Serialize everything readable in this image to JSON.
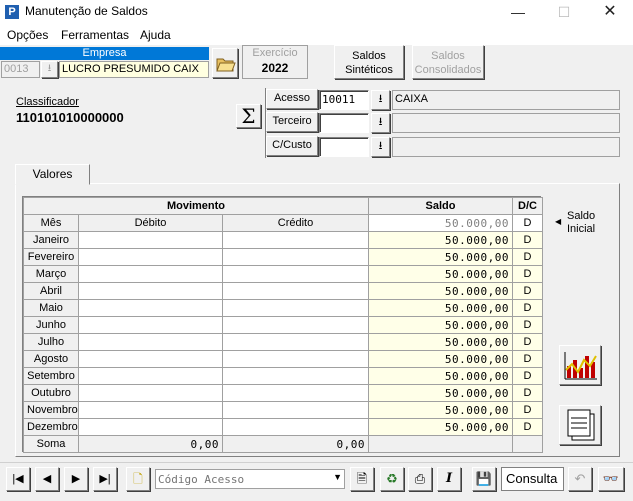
{
  "window": {
    "title": "Manutenção de Saldos"
  },
  "menu": [
    "Opções",
    "Ferramentas",
    "Ajuda"
  ],
  "empresa": {
    "label": "Empresa",
    "code": "0013",
    "name": "LUCRO PRESUMIDO CAIX"
  },
  "exercicio": {
    "label": "Exercício",
    "year": "2022"
  },
  "buttons": {
    "saldos_sinteticos": [
      "Saldos",
      "Sintéticos"
    ],
    "saldos_consolidados": [
      "Saldos",
      "Consolidados"
    ]
  },
  "classificador": {
    "label": "Classificador",
    "value": "110101010000000"
  },
  "fields": {
    "acesso": {
      "label": "Acesso",
      "value": "10011",
      "desc": "CAIXA"
    },
    "terceiro": {
      "label": "Terceiro",
      "value": "",
      "desc": ""
    },
    "ccusto": {
      "label": "C/Custo",
      "value": "",
      "desc": ""
    }
  },
  "tab": "Valores",
  "table": {
    "group_headers": {
      "movimento": "Movimento",
      "saldo": "Saldo",
      "dc": "D/C"
    },
    "columns": {
      "mes": "Mês",
      "debito": "Débito",
      "credito": "Crédito"
    },
    "inicial": {
      "saldo": "50.000,00",
      "dc": "D"
    },
    "rows": [
      {
        "mes": "Janeiro",
        "debito": "",
        "credito": "",
        "saldo": "50.000,00",
        "dc": "D"
      },
      {
        "mes": "Fevereiro",
        "debito": "",
        "credito": "",
        "saldo": "50.000,00",
        "dc": "D"
      },
      {
        "mes": "Março",
        "debito": "",
        "credito": "",
        "saldo": "50.000,00",
        "dc": "D"
      },
      {
        "mes": "Abril",
        "debito": "",
        "credito": "",
        "saldo": "50.000,00",
        "dc": "D"
      },
      {
        "mes": "Maio",
        "debito": "",
        "credito": "",
        "saldo": "50.000,00",
        "dc": "D"
      },
      {
        "mes": "Junho",
        "debito": "",
        "credito": "",
        "saldo": "50.000,00",
        "dc": "D"
      },
      {
        "mes": "Julho",
        "debito": "",
        "credito": "",
        "saldo": "50.000,00",
        "dc": "D"
      },
      {
        "mes": "Agosto",
        "debito": "",
        "credito": "",
        "saldo": "50.000,00",
        "dc": "D"
      },
      {
        "mes": "Setembro",
        "debito": "",
        "credito": "",
        "saldo": "50.000,00",
        "dc": "D"
      },
      {
        "mes": "Outubro",
        "debito": "",
        "credito": "",
        "saldo": "50.000,00",
        "dc": "D"
      },
      {
        "mes": "Novembro",
        "debito": "",
        "credito": "",
        "saldo": "50.000,00",
        "dc": "D"
      },
      {
        "mes": "Dezembro",
        "debito": "",
        "credito": "",
        "saldo": "50.000,00",
        "dc": "D"
      }
    ],
    "soma": {
      "label": "Soma",
      "debito": "0,00",
      "credito": "0,00"
    }
  },
  "saldo_inicial_label": [
    "Saldo",
    "Inicial"
  ],
  "toolbar": {
    "search_placeholder": "Código Acesso",
    "consulta": "Consulta"
  },
  "colors": {
    "accent": "#0078d7",
    "cell_yellow": "#ffffe8"
  }
}
